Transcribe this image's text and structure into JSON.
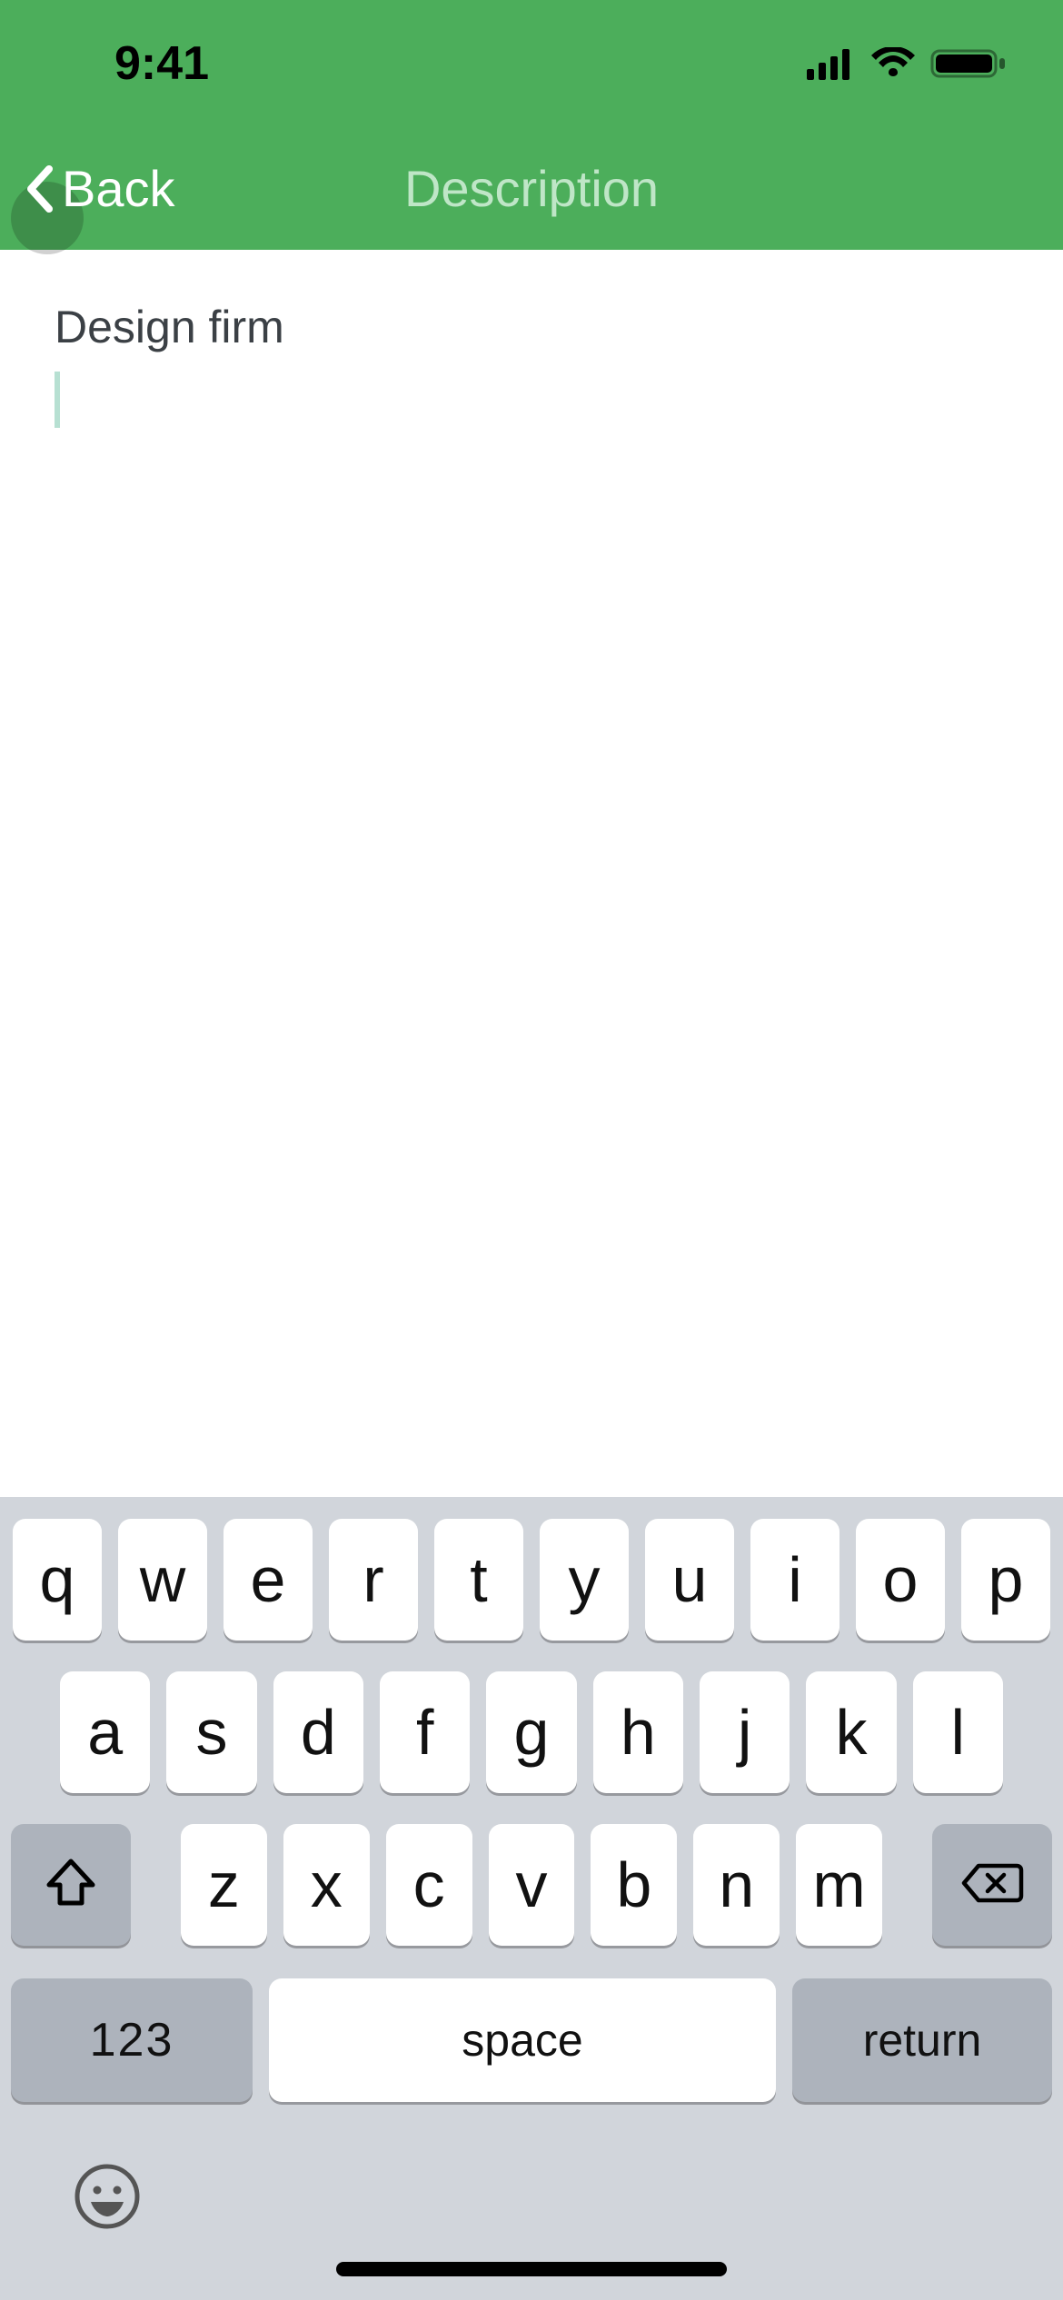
{
  "status": {
    "time": "9:41"
  },
  "nav": {
    "back_label": "Back",
    "title": "Description"
  },
  "editor": {
    "text": "Design firm"
  },
  "keyboard": {
    "row1": [
      "q",
      "w",
      "e",
      "r",
      "t",
      "y",
      "u",
      "i",
      "o",
      "p"
    ],
    "row2": [
      "a",
      "s",
      "d",
      "f",
      "g",
      "h",
      "j",
      "k",
      "l"
    ],
    "row3": [
      "z",
      "x",
      "c",
      "v",
      "b",
      "n",
      "m"
    ],
    "numbers_label": "123",
    "space_label": "space",
    "return_label": "return"
  }
}
